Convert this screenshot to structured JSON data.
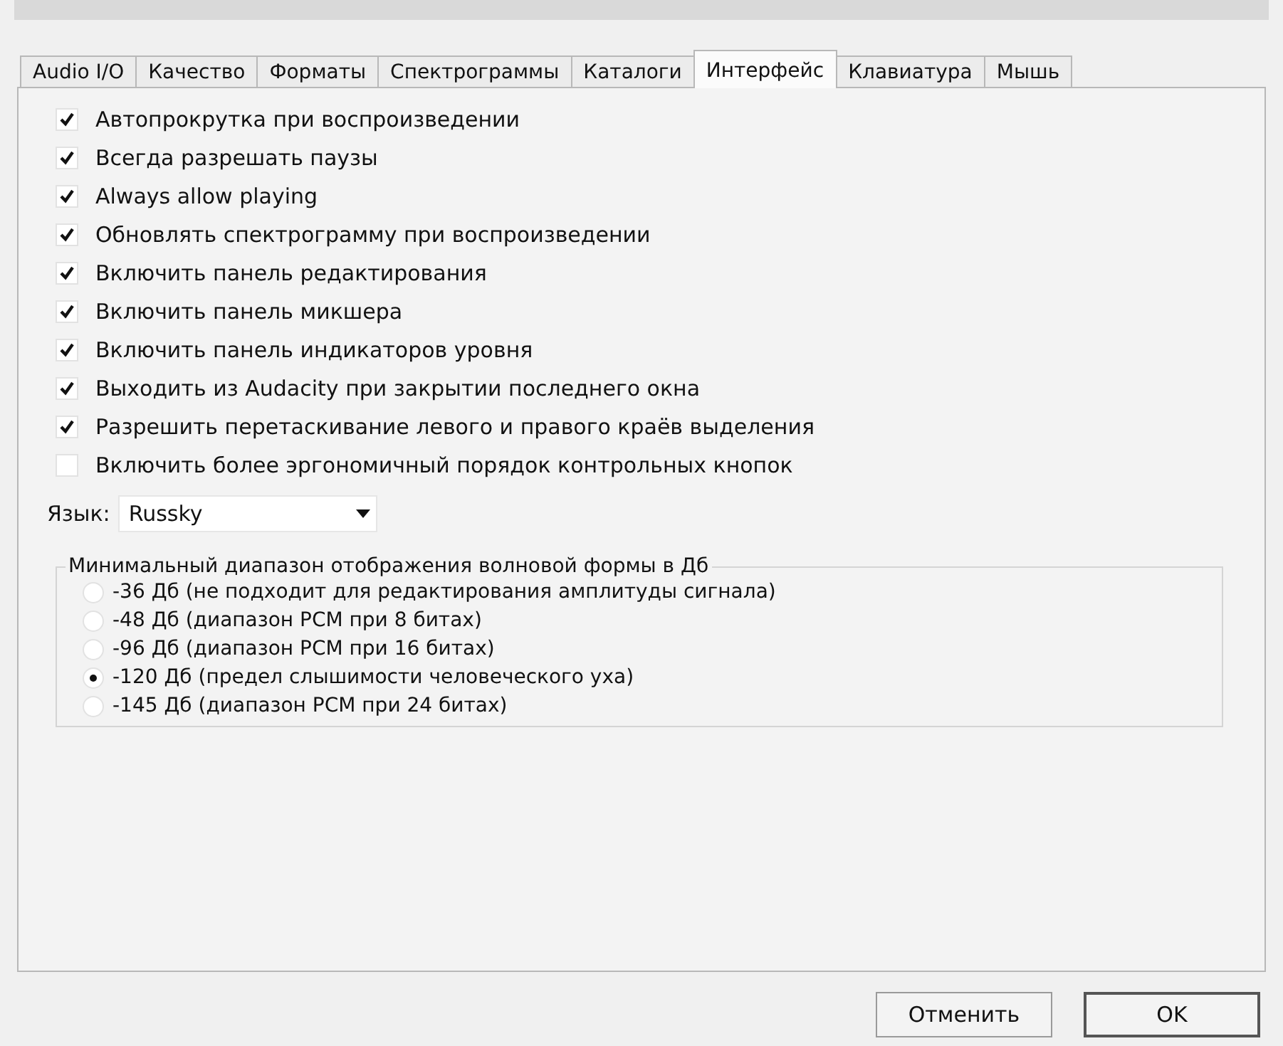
{
  "tabs": [
    {
      "label": "Audio I/O",
      "selected": false
    },
    {
      "label": "Качество",
      "selected": false
    },
    {
      "label": "Форматы",
      "selected": false
    },
    {
      "label": "Спектрограммы",
      "selected": false
    },
    {
      "label": "Каталоги",
      "selected": false
    },
    {
      "label": "Интерфейс",
      "selected": true
    },
    {
      "label": "Клавиатура",
      "selected": false
    },
    {
      "label": "Мышь",
      "selected": false
    }
  ],
  "options": [
    {
      "label": "Автопрокрутка при воспроизведении",
      "checked": true
    },
    {
      "label": "Всегда разрешать паузы",
      "checked": true
    },
    {
      "label": "Always allow playing",
      "checked": true
    },
    {
      "label": "Обновлять спектрограмму при воспроизведении",
      "checked": true
    },
    {
      "label": "Включить панель редактирования",
      "checked": true
    },
    {
      "label": "Включить панель микшера",
      "checked": true
    },
    {
      "label": "Включить панель индикаторов уровня",
      "checked": true
    },
    {
      "label": "Выходить из Audacity при закрытии последнего окна",
      "checked": true
    },
    {
      "label": "Разрешить перетаскивание левого и правого краёв выделения",
      "checked": true
    },
    {
      "label": "Включить более эргономичный порядок контрольных кнопок",
      "checked": false
    }
  ],
  "language": {
    "label": "Язык:",
    "value": "Russky"
  },
  "range_group": {
    "title": "Минимальный диапазон отображения волновой формы в Дб",
    "choices": [
      {
        "label": "-36 Дб (не подходит для редактирования амплитуды сигнала)",
        "selected": false
      },
      {
        "label": "-48 Дб (диапазон PCM при 8 битах)",
        "selected": false
      },
      {
        "label": "-96 Дб (диапазон PCM при 16 битах)",
        "selected": false
      },
      {
        "label": "-120 Дб (предел слышимости человеческого уха)",
        "selected": true
      },
      {
        "label": "-145 Дб (диапазон PCM при 24 битах)",
        "selected": false
      }
    ]
  },
  "buttons": [
    {
      "label": "Отменить",
      "kind": "normal"
    },
    {
      "label": "OK",
      "kind": "default"
    }
  ]
}
